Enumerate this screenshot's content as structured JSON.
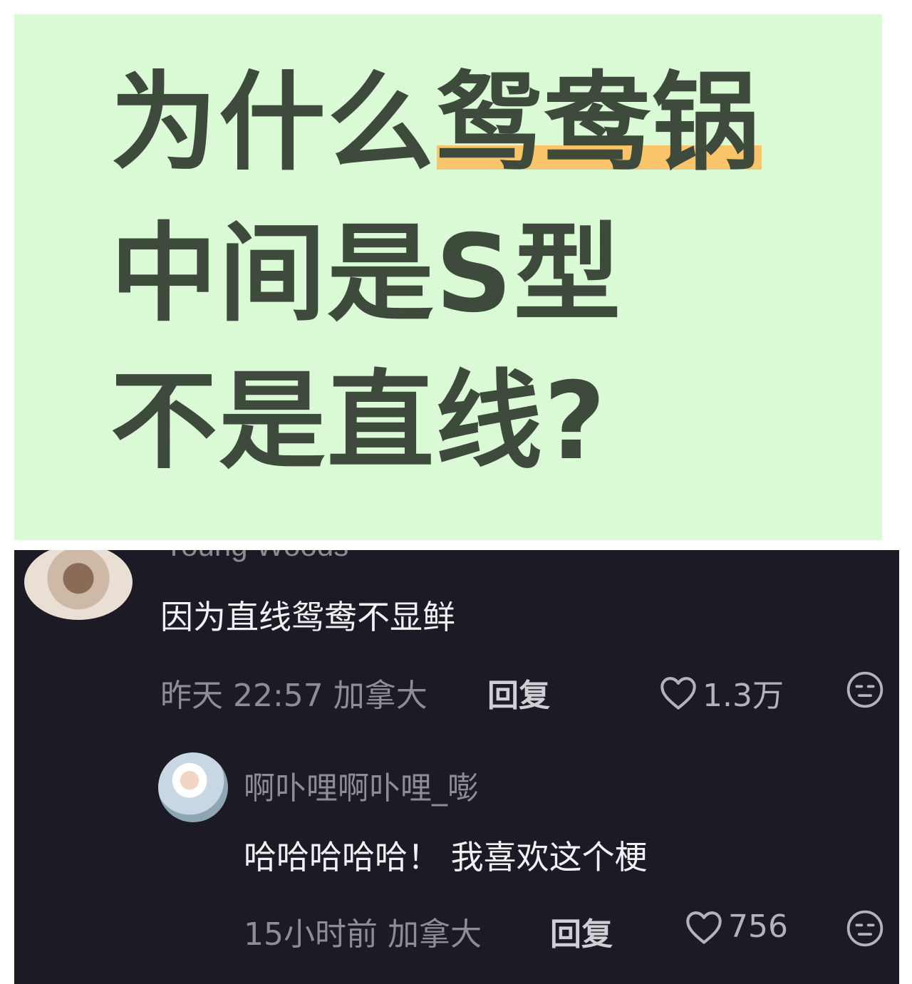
{
  "title_card": {
    "line1_prefix": "为什么",
    "line1_highlight": "鸳鸯锅",
    "line2": "中间是S型",
    "line3": "不是直线?"
  },
  "comments": {
    "top_cut_username": "Young Woods",
    "comment1": {
      "text": "因为直线鸳鸯不显鲜",
      "meta": "昨天 22:57 加拿大",
      "reply_label": "回复",
      "likes": "1.3万"
    },
    "reply1": {
      "username": "啊卟哩啊卟哩_嘭",
      "text": "哈哈哈哈哈！ 我喜欢这个梗",
      "meta": "15小时前 加拿大",
      "reply_label": "回复",
      "likes": "756"
    }
  },
  "icons": {
    "like": "heart-outline-icon",
    "dislike": "meh-face-icon"
  },
  "colors": {
    "card_bg": "#d9fad5",
    "title_text": "#3e4a3c",
    "highlight": "#f9c46a",
    "dark_bg": "#1b1a25"
  }
}
